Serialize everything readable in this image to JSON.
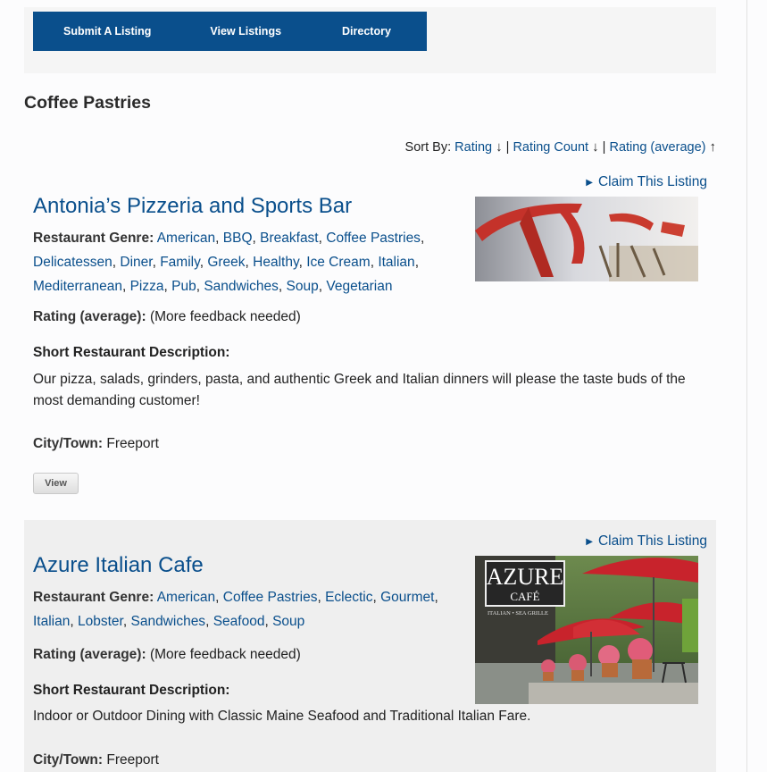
{
  "nav": {
    "items": [
      "Submit A Listing",
      "View Listings",
      "Directory"
    ]
  },
  "page": {
    "title": "Coffee Pastries"
  },
  "sort": {
    "label": "Sort By:",
    "options": [
      {
        "label": "Rating",
        "arrow": "↓"
      },
      {
        "label": "Rating Count",
        "arrow": "↓"
      },
      {
        "label": "Rating (average)",
        "arrow": "↑"
      }
    ],
    "separator": "|"
  },
  "labels": {
    "claim": "Claim This Listing",
    "genre": "Restaurant Genre:",
    "rating": "Rating (average):",
    "description": "Short Restaurant Description:",
    "city": "City/Town:",
    "view": "View"
  },
  "listings": [
    {
      "title": "Antonia’s Pizzeria and Sports Bar",
      "genres": [
        "American",
        "BBQ",
        "Breakfast",
        "Coffee Pastries",
        "Delicatessen",
        "Diner",
        "Family",
        "Greek",
        "Healthy",
        "Ice Cream",
        "Italian",
        "Mediterranean",
        "Pizza",
        "Pub",
        "Sandwiches",
        "Soup",
        "Vegetarian"
      ],
      "rating": "(More feedback needed)",
      "description": "Our pizza, salads, grinders, pasta, and authentic Greek and Italian dinners will please the taste buds of the most demanding customer!",
      "city": "Freeport"
    },
    {
      "title": "Azure Italian Cafe",
      "genres": [
        "American",
        "Coffee Pastries",
        "Eclectic",
        "Gourmet",
        "Italian",
        "Lobster",
        "Sandwiches",
        "Seafood",
        "Soup"
      ],
      "rating": "(More feedback needed)",
      "description": "Indoor or Outdoor Dining with Classic Maine Seafood and Traditional Italian Fare.",
      "city": "Freeport",
      "sign": {
        "name": "AZURE",
        "sub": "CAFÉ",
        "tagline": "ITALIAN • SEA GRILLE"
      }
    }
  ],
  "colors": {
    "nav_bg": "#0a4f8c",
    "link": "#0a4f8c",
    "alt_bg": "#efefef"
  }
}
